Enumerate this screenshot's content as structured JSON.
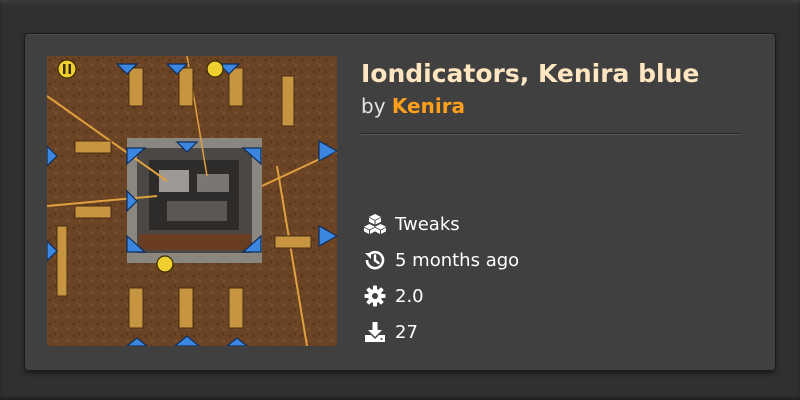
{
  "mod": {
    "title": "Iondicators, Kenira blue",
    "by_prefix": "by",
    "author": "Kenira",
    "thumbnail_icon": "factory-screenshot"
  },
  "meta": [
    {
      "icon": "cubes-icon",
      "text": "Tweaks"
    },
    {
      "icon": "history-icon",
      "text": "5 months ago"
    },
    {
      "icon": "gear-icon",
      "text": "2.0"
    },
    {
      "icon": "download-icon",
      "text": "27"
    }
  ],
  "colors": {
    "title": "#ffe6c0",
    "author": "#ff9f1b",
    "indicator_blue": "#3a86e0",
    "card": "#414040"
  }
}
